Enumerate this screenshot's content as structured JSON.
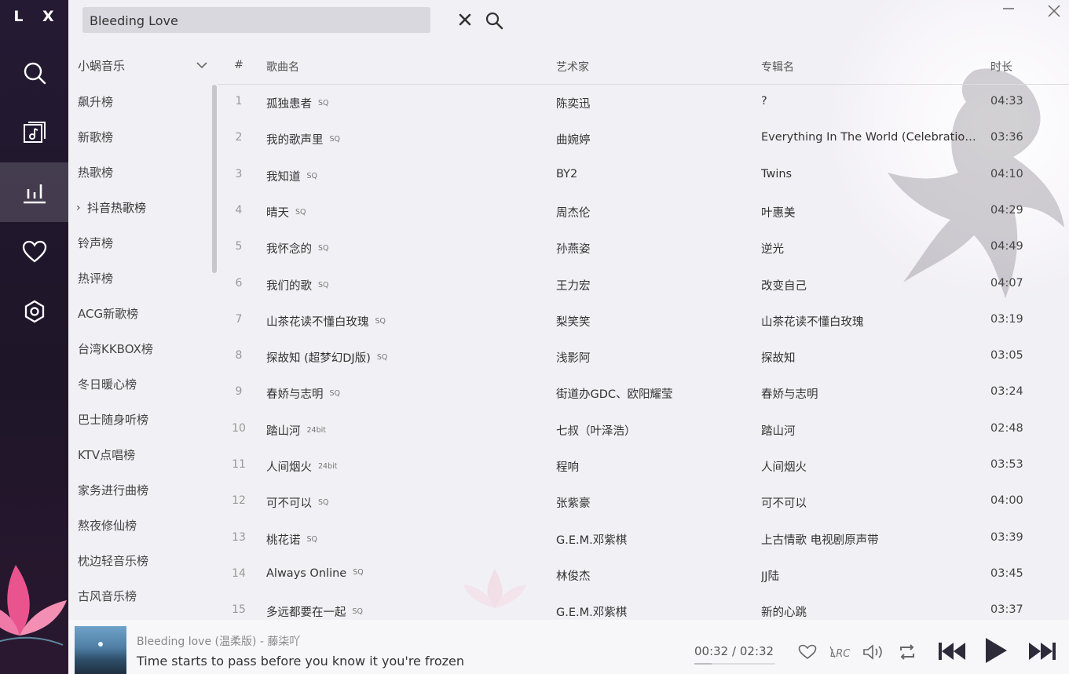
{
  "app": {
    "logo": "L X"
  },
  "sidebar": {
    "items": [
      {
        "name": "search",
        "icon": "search-icon"
      },
      {
        "name": "songlist",
        "icon": "music-list-icon"
      },
      {
        "name": "leaderboard",
        "icon": "bar-chart-icon",
        "active": true
      },
      {
        "name": "favorites",
        "icon": "heart-icon"
      },
      {
        "name": "settings",
        "icon": "settings-icon"
      }
    ]
  },
  "search": {
    "value": "Bleeding Love",
    "placeholder": ""
  },
  "source": {
    "label": "小蜗音乐"
  },
  "boards": [
    {
      "label": "飙升榜"
    },
    {
      "label": "新歌榜"
    },
    {
      "label": "热歌榜"
    },
    {
      "label": "抖音热歌榜",
      "active": true
    },
    {
      "label": "铃声榜"
    },
    {
      "label": "热评榜"
    },
    {
      "label": "ACG新歌榜"
    },
    {
      "label": "台湾KKBOX榜"
    },
    {
      "label": "冬日暖心榜"
    },
    {
      "label": "巴士随身听榜"
    },
    {
      "label": "KTV点唱榜"
    },
    {
      "label": "家务进行曲榜"
    },
    {
      "label": "熬夜修仙榜"
    },
    {
      "label": "枕边轻音乐榜"
    },
    {
      "label": "古风音乐榜"
    }
  ],
  "table": {
    "headers": {
      "index": "#",
      "name": "歌曲名",
      "artist": "艺术家",
      "album": "专辑名",
      "duration": "时长"
    },
    "rows": [
      {
        "index": "1",
        "name": "孤独患者",
        "quality": "SQ",
        "artist": "陈奕迅",
        "album": "?",
        "duration": "04:33"
      },
      {
        "index": "2",
        "name": "我的歌声里",
        "quality": "SQ",
        "artist": "曲婉婷",
        "album": "Everything In The World (Celebration Edition)",
        "duration": "03:36"
      },
      {
        "index": "3",
        "name": "我知道",
        "quality": "SQ",
        "artist": "BY2",
        "album": "Twins",
        "duration": "04:10"
      },
      {
        "index": "4",
        "name": "晴天",
        "quality": "SQ",
        "artist": "周杰伦",
        "album": "叶惠美",
        "duration": "04:29"
      },
      {
        "index": "5",
        "name": "我怀念的",
        "quality": "SQ",
        "artist": "孙燕姿",
        "album": "逆光",
        "duration": "04:49"
      },
      {
        "index": "6",
        "name": "我们的歌",
        "quality": "SQ",
        "artist": "王力宏",
        "album": "改变自己",
        "duration": "04:07"
      },
      {
        "index": "7",
        "name": "山茶花读不懂白玫瑰",
        "quality": "SQ",
        "artist": "梨笑笑",
        "album": "山茶花读不懂白玫瑰",
        "duration": "03:19"
      },
      {
        "index": "8",
        "name": "探故知 (超梦幻DJ版)",
        "quality": "SQ",
        "artist": "浅影阿",
        "album": "探故知",
        "duration": "03:05"
      },
      {
        "index": "9",
        "name": "春娇与志明",
        "quality": "SQ",
        "artist": "街道办GDC、欧阳耀莹",
        "album": "春娇与志明",
        "duration": "03:24"
      },
      {
        "index": "10",
        "name": "踏山河",
        "quality": "24bit",
        "artist": "七叔（叶泽浩）",
        "album": "踏山河",
        "duration": "02:48"
      },
      {
        "index": "11",
        "name": "人间烟火",
        "quality": "24bit",
        "artist": "程响",
        "album": "人间烟火",
        "duration": "03:53"
      },
      {
        "index": "12",
        "name": "可不可以",
        "quality": "SQ",
        "artist": "张紫豪",
        "album": "可不可以",
        "duration": "04:00"
      },
      {
        "index": "13",
        "name": "桃花诺",
        "quality": "SQ",
        "artist": "G.E.M.邓紫棋",
        "album": "上古情歌 电视剧原声带",
        "duration": "03:39"
      },
      {
        "index": "14",
        "name": "Always Online",
        "quality": "SQ",
        "artist": "林俊杰",
        "album": "JJ陆",
        "duration": "03:45"
      },
      {
        "index": "15",
        "name": "多远都要在一起",
        "quality": "SQ",
        "artist": "G.E.M.邓紫棋",
        "album": "新的心跳",
        "duration": "03:37"
      }
    ]
  },
  "player": {
    "title": "Bleeding love (温柔版) - 藤柒吖",
    "lyric": "Time starts to pass before you know it you're frozen",
    "current_time": "00:32",
    "separator": "/",
    "total_time": "02:32",
    "progress": 0.21,
    "icons": [
      "heart-outline-icon",
      "lyrics-icon",
      "volume-icon",
      "repeat-icon",
      "previous-icon",
      "play-icon",
      "next-icon"
    ]
  },
  "colors": {
    "sidebar": "#241a33",
    "accent": "#2d2a3a",
    "background": "#f1f0f4"
  }
}
